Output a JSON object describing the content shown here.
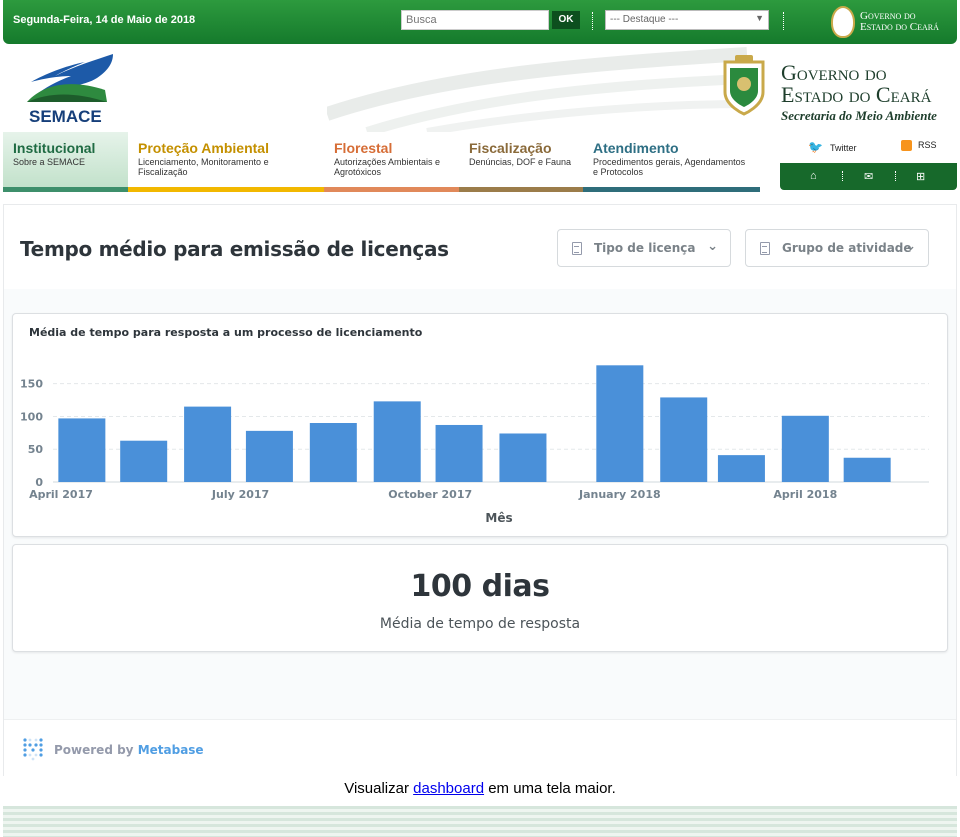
{
  "topbar": {
    "date": "Segunda-Feira, 14 de Maio de 2018",
    "search_placeholder": "Busca",
    "search_button": "OK",
    "destaque_selected": "--- Destaque ---",
    "gov_line1": "Governo do",
    "gov_line2": "Estado do Ceará"
  },
  "header": {
    "logo_text": "SEMACE",
    "gov_line1": "Governo do",
    "gov_line2": "Estado do Ceará",
    "gov_line3": "Secretaria do Meio Ambiente"
  },
  "nav": {
    "items": [
      {
        "title": "Institucional",
        "sub": "Sobre a SEMACE"
      },
      {
        "title": "Proteção Ambiental",
        "sub": "Licenciamento, Monitoramento e Fiscalização"
      },
      {
        "title": "Florestal",
        "sub": "Autorizações Ambientais e Agrotóxicos"
      },
      {
        "title": "Fiscalização",
        "sub": "Denúncias, DOF e Fauna"
      },
      {
        "title": "Atendimento",
        "sub": "Procedimentos gerais, Agendamentos e Protocolos"
      }
    ],
    "twitter": "Twitter",
    "rss": "RSS"
  },
  "dashboard": {
    "title": "Tempo médio para emissão de licenças",
    "filter1": "Tipo de licença",
    "filter2": "Grupo de atividade",
    "chart_title": "Média de tempo para resposta a um processo de licenciamento",
    "number_value": "100 dias",
    "number_label": "Média de tempo de resposta",
    "powered_by": "Powered by",
    "powered_brand": "Metabase"
  },
  "below": {
    "before": "Visualizar ",
    "link": "dashboard",
    "after": " em uma tela maior."
  },
  "chart_data": {
    "type": "bar",
    "categories": [
      "April 2017",
      "May 2017",
      "June 2017",
      "July 2017",
      "August 2017",
      "September 2017",
      "October 2017",
      "November 2017",
      "December 2017",
      "January 2018",
      "February 2018",
      "March 2018",
      "April 2018",
      "May 2018"
    ],
    "values": [
      97,
      63,
      115,
      78,
      90,
      123,
      87,
      74,
      178,
      129,
      41,
      101,
      37
    ],
    "x_dates": [
      "2017-04-15",
      "2017-05-15",
      "2017-06-15",
      "2017-07-15",
      "2017-08-15",
      "2017-09-15",
      "2017-10-15",
      "2017-11-15",
      "2018-01-01",
      "2018-02-01",
      "2018-03-01",
      "2018-04-01",
      "2018-05-01"
    ],
    "xticks": [
      "April 2017",
      "July 2017",
      "October 2017",
      "January 2018",
      "April 2018"
    ],
    "xtick_dates": [
      "2017-04-01",
      "2017-07-01",
      "2017-10-01",
      "2018-01-01",
      "2018-04-01"
    ],
    "yticks": [
      0,
      50,
      100,
      150
    ],
    "ylim": [
      0,
      180
    ],
    "xlim": [
      "2017-04-01",
      "2018-05-31"
    ],
    "xlabel": "Mês",
    "ylabel": "",
    "bar_color": "#4a90d9",
    "grid": true
  }
}
